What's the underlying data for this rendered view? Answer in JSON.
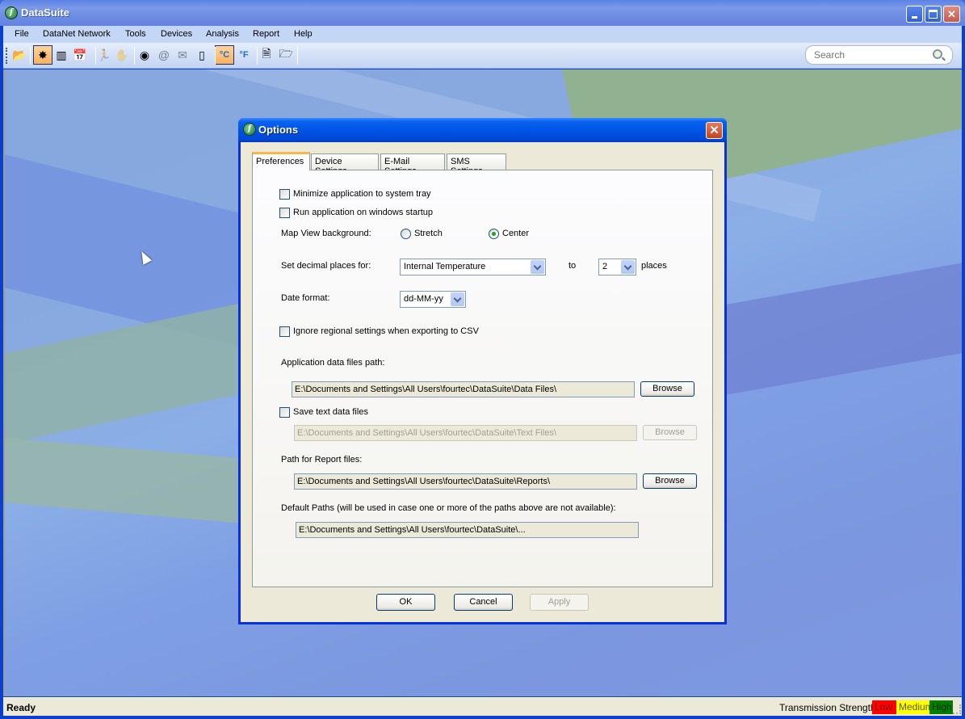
{
  "app": {
    "title": "DataSuite",
    "icon": "datasuite-logo-icon",
    "window_controls": [
      "minimize",
      "maximize",
      "close"
    ]
  },
  "menu": [
    "File",
    "DataNet Network",
    "Tools",
    "Devices",
    "Analysis",
    "Report",
    "Help"
  ],
  "toolbar": {
    "buttons": [
      {
        "name": "open-icon",
        "glyph": "📂",
        "active": false,
        "enabled": true
      },
      {
        "name": "network-star-icon",
        "glyph": "✸",
        "active": true,
        "enabled": true
      },
      {
        "name": "readout-icon",
        "glyph": "▥",
        "active": false,
        "enabled": true
      },
      {
        "name": "calendar-icon",
        "glyph": "📅",
        "active": false,
        "enabled": true
      },
      {
        "name": "run-icon",
        "glyph": "🏃",
        "active": false,
        "enabled": false
      },
      {
        "name": "stop-icon",
        "glyph": "✋",
        "active": false,
        "enabled": false
      },
      {
        "name": "camera-icon",
        "glyph": "◉",
        "active": false,
        "enabled": true
      },
      {
        "name": "email-icon",
        "glyph": "@",
        "active": false,
        "enabled": false
      },
      {
        "name": "sms-icon",
        "glyph": "✉",
        "active": false,
        "enabled": false
      },
      {
        "name": "phone-icon",
        "glyph": "▯",
        "active": false,
        "enabled": true
      },
      {
        "name": "celsius-icon",
        "glyph": "°C",
        "active": true,
        "enabled": true
      },
      {
        "name": "fahrenheit-icon",
        "glyph": "°F",
        "active": false,
        "enabled": true
      },
      {
        "name": "report-settings-icon",
        "glyph": "🗎",
        "active": false,
        "enabled": true
      },
      {
        "name": "report-open-icon",
        "glyph": "🗁",
        "active": false,
        "enabled": true
      }
    ],
    "search_placeholder": "Search"
  },
  "dialog": {
    "title": "Options",
    "tabs": [
      "Preferences",
      "Device Settings",
      "E-Mail Settings",
      "SMS Settings"
    ],
    "selected_tab": "Preferences",
    "preferences": {
      "minimize_to_tray": {
        "label": "Minimize application to system tray",
        "checked": false
      },
      "run_on_startup": {
        "label": "Run application on windows startup",
        "checked": false
      },
      "map_view": {
        "label": "Map View background:",
        "options": [
          "Stretch",
          "Center"
        ],
        "selected": "Center"
      },
      "decimal": {
        "label": "Set decimal places for:",
        "field": "Internal Temperature",
        "to_label": "to",
        "places": "2",
        "places_label": "places"
      },
      "date_format": {
        "label": "Date format:",
        "value": "dd-MM-yy"
      },
      "ignore_regional": {
        "label": "Ignore regional settings when exporting to CSV",
        "checked": false
      },
      "data_path": {
        "label": "Application data files path:",
        "value": "E:\\Documents and Settings\\All Users\\fourtec\\DataSuite\\Data Files\\",
        "browse": "Browse"
      },
      "save_text": {
        "label": "Save text data files",
        "checked": false,
        "value": "E:\\Documents and Settings\\All Users\\fourtec\\DataSuite\\Text Files\\",
        "browse": "Browse"
      },
      "report_path": {
        "label": "Path for Report files:",
        "value": "E:\\Documents and Settings\\All Users\\fourtec\\DataSuite\\Reports\\",
        "browse": "Browse"
      },
      "default_paths": {
        "label": "Default Paths (will be used in case one or more of the paths above are not available):",
        "value": "E:\\Documents and Settings\\All Users\\fourtec\\DataSuite\\..."
      }
    },
    "buttons": {
      "ok": "OK",
      "cancel": "Cancel",
      "apply": "Apply"
    }
  },
  "status": {
    "text": "Ready",
    "transmission_label": "Transmission Strength:",
    "levels": [
      {
        "label": "Low",
        "color": "#ff0000"
      },
      {
        "label": "Medium",
        "color": "#ffff00"
      },
      {
        "label": "High",
        "color": "#008000"
      }
    ]
  }
}
